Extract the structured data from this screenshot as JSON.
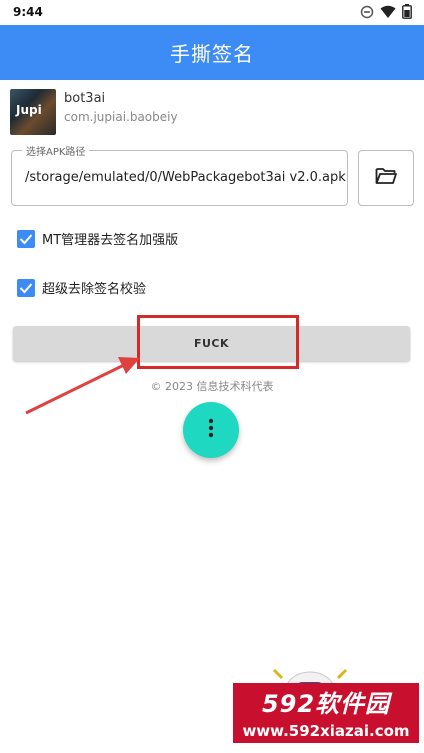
{
  "status_bar": {
    "time": "9:44"
  },
  "app_bar": {
    "title": "手撕签名"
  },
  "app_info": {
    "icon_text": "Jupi",
    "name": "bot3ai",
    "package": "com.jupiai.baobeiy"
  },
  "apk_field": {
    "label": "选择APK路径",
    "value": "/storage/emulated/0/WebPackagebot3ai v2.0.apk"
  },
  "options": [
    {
      "label": "MT管理器去签名加强版",
      "checked": true
    },
    {
      "label": "超级去除签名校验",
      "checked": true
    }
  ],
  "action_button": {
    "label": "FUCK"
  },
  "footer": {
    "copyright": "© 2023 信息技术科代表"
  },
  "watermark": {
    "main": "592软件园",
    "url": "www.592xiazai.com"
  },
  "colors": {
    "appbar": "#3d8bf5",
    "checkbox": "#3d8bf5",
    "fab": "#1fd8c2",
    "highlight": "#d42a2a",
    "watermark": "#c8102e"
  }
}
